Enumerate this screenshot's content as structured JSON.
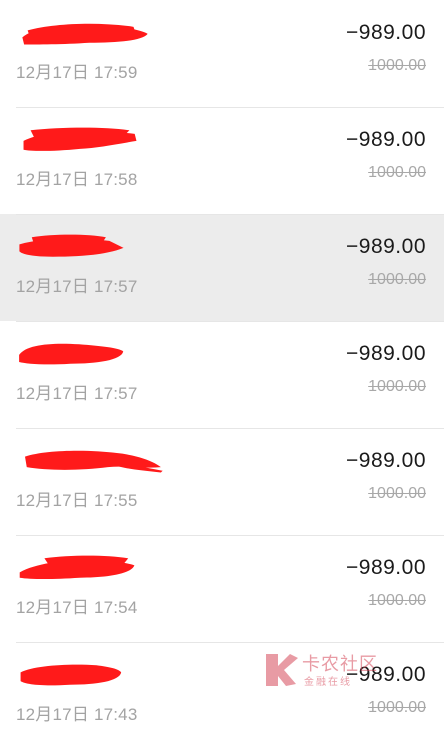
{
  "transactions": [
    {
      "time": "12月17日 17:59",
      "amount": "−989.00",
      "original": "1000.00",
      "highlighted": false
    },
    {
      "time": "12月17日 17:58",
      "amount": "−989.00",
      "original": "1000.00",
      "highlighted": false
    },
    {
      "time": "12月17日 17:57",
      "amount": "−989.00",
      "original": "1000.00",
      "highlighted": true
    },
    {
      "time": "12月17日 17:57",
      "amount": "−989.00",
      "original": "1000.00",
      "highlighted": false
    },
    {
      "time": "12月17日 17:55",
      "amount": "−989.00",
      "original": "1000.00",
      "highlighted": false
    },
    {
      "time": "12月17日 17:54",
      "amount": "−989.00",
      "original": "1000.00",
      "highlighted": false
    },
    {
      "time": "12月17日 17:43",
      "amount": "−989.00",
      "original": "1000.00",
      "highlighted": false
    }
  ],
  "watermark": {
    "title": "卡农社区",
    "subtitle": "金融在线"
  },
  "colors": {
    "redaction": "#ff1a1a",
    "highlight_row": "#ececec",
    "amount": "#1b1b1b",
    "muted": "#a3a3a3",
    "watermark": "#d64a5b"
  }
}
